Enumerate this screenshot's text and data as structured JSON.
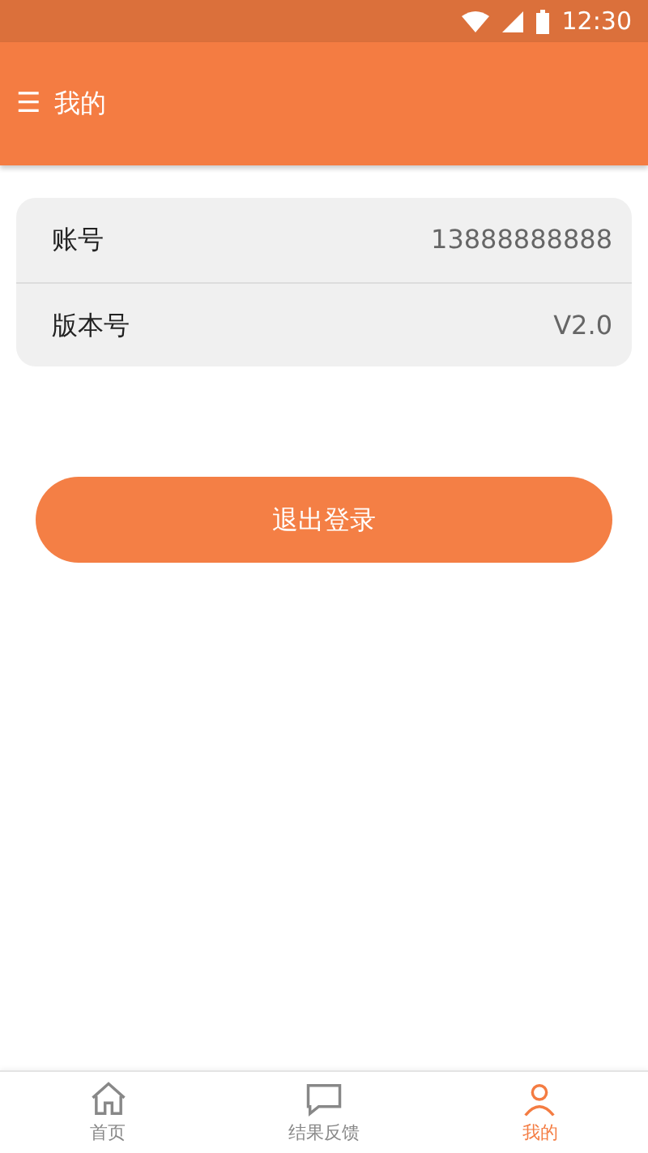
{
  "status_bar": {
    "time": "12:30"
  },
  "app_bar": {
    "title": "我的",
    "menu_icon": "☰"
  },
  "info_rows": [
    {
      "label": "账号",
      "value": "13888888888"
    },
    {
      "label": "版本号",
      "value": "V2.0"
    }
  ],
  "logout_button": "退出登录",
  "tabs": [
    {
      "label": "首页",
      "kind": "home",
      "selected": false
    },
    {
      "label": "结果反馈",
      "kind": "feedback",
      "selected": false
    },
    {
      "label": "我的",
      "kind": "profile",
      "selected": true
    }
  ]
}
